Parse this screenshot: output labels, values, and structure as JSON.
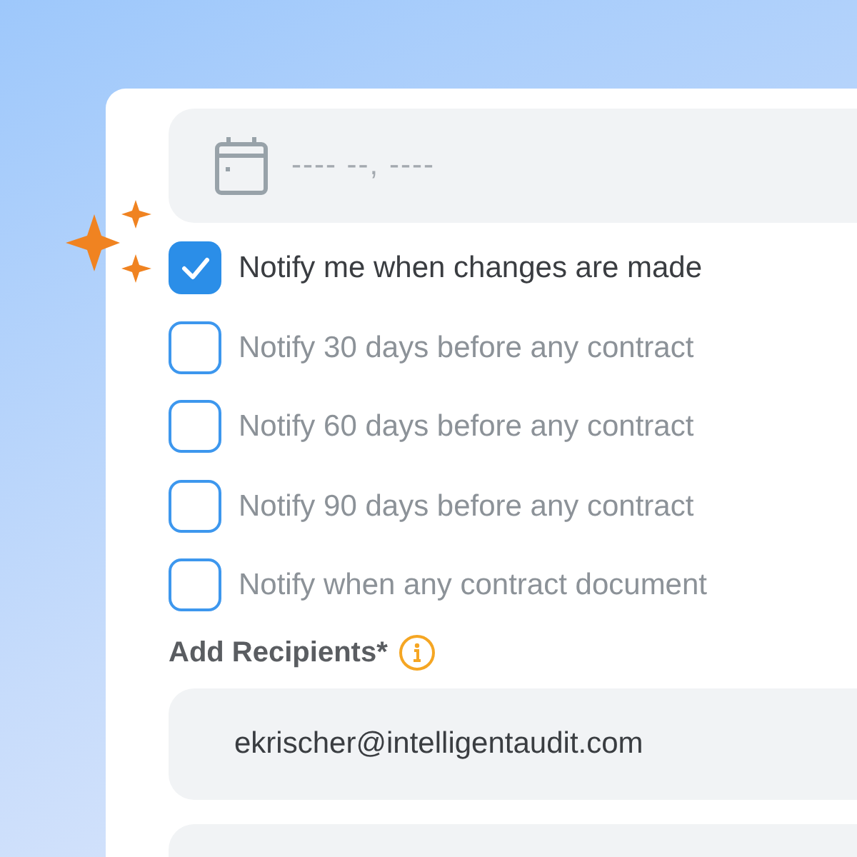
{
  "date_field": {
    "placeholder": "---- --, ----"
  },
  "options": [
    {
      "label": "Notify me when changes are made",
      "checked": true
    },
    {
      "label": "Notify 30 days before any contract",
      "checked": false
    },
    {
      "label": "Notify 60 days before any contract",
      "checked": false
    },
    {
      "label": "Notify 90 days before any contract",
      "checked": false
    },
    {
      "label": "Notify when any contract document",
      "checked": false
    }
  ],
  "recipients": {
    "label": "Add Recipients*",
    "value": "ekrischer@intelligentaudit.com"
  }
}
